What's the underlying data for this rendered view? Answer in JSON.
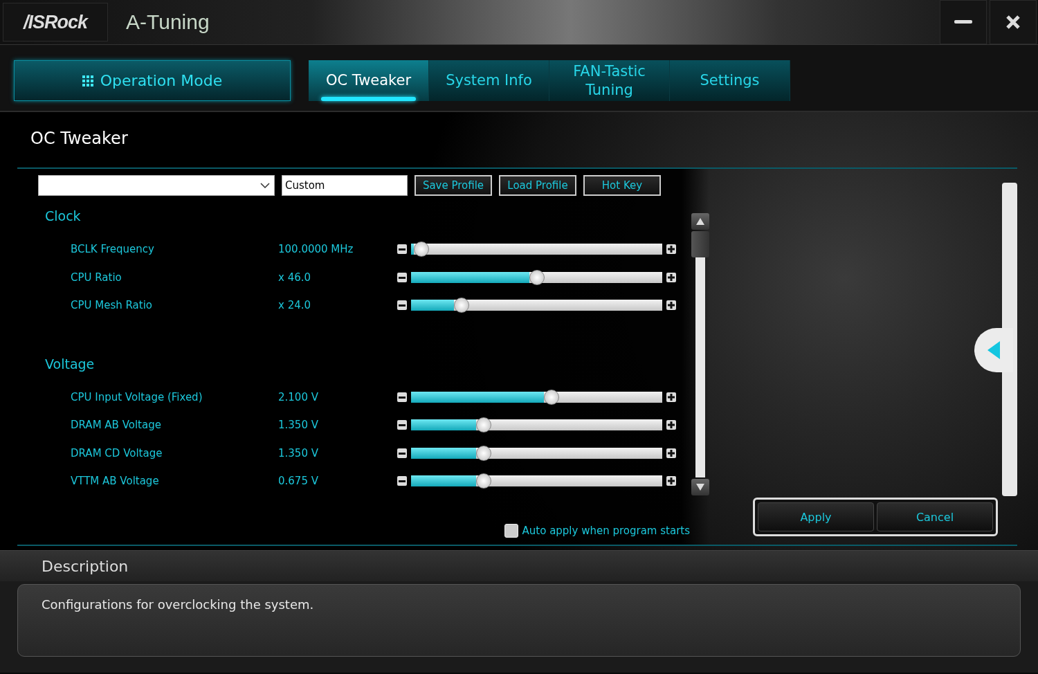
{
  "window": {
    "logo": "/ISRock",
    "title": "A-Tuning"
  },
  "nav": {
    "mode_button": "Operation Mode",
    "tabs": [
      {
        "label": "OC Tweaker",
        "selected": true
      },
      {
        "label": "System Info",
        "selected": false
      },
      {
        "label": "FAN-Tastic Tuning",
        "selected": false
      },
      {
        "label": "Settings",
        "selected": false
      }
    ]
  },
  "page_title": "OC Tweaker",
  "toolbar": {
    "profile_value": "Custom",
    "buttons": [
      "Save Profile",
      "Load Profile",
      "Hot Key"
    ]
  },
  "sections": [
    {
      "title": "Clock",
      "rows": [
        {
          "name": "BCLK Frequency",
          "reading": "100.0000 MHz",
          "level": 0.04
        },
        {
          "name": "CPU Ratio",
          "reading": "x 46.0",
          "level": 0.5
        },
        {
          "name": "CPU Mesh Ratio",
          "reading": "x 24.0",
          "level": 0.2
        }
      ]
    },
    {
      "title": "Voltage",
      "rows": [
        {
          "name": "CPU Input Voltage (Fixed)",
          "reading": "2.100 V",
          "level": 0.56
        },
        {
          "name": "DRAM AB Voltage",
          "reading": "1.350 V",
          "level": 0.29
        },
        {
          "name": "DRAM CD Voltage",
          "reading": "1.350 V",
          "level": 0.29
        },
        {
          "name": "VTTM AB Voltage",
          "reading": "0.675 V",
          "level": 0.29
        }
      ]
    }
  ],
  "auto_apply": {
    "label": "Auto apply when program starts",
    "checked": false
  },
  "actions": [
    "Apply",
    "Cancel"
  ],
  "description": {
    "title": "Description",
    "text": "Configurations for overclocking the system."
  }
}
